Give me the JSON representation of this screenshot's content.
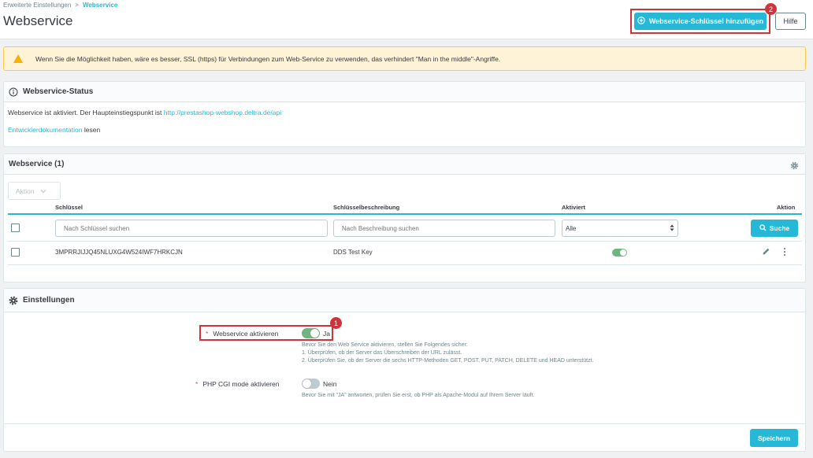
{
  "breadcrumb": {
    "parent": "Erweiterte Einstellungen",
    "separator": ">",
    "current": "Webservice"
  },
  "header": {
    "title": "Webservice",
    "add_key_label": "Webservice-Schlüssel hinzufügen",
    "help_label": "Hilfe",
    "callout_add": "2"
  },
  "alert": {
    "text": "Wenn Sie die Möglichkeit haben, wäre es besser, SSL (https) für Verbindungen zum Web-Service zu verwenden, das verhindert \"Man in the middle\"-Angriffe."
  },
  "status_card": {
    "title": "Webservice-Status",
    "line1_prefix": "Webservice ist aktiviert. Der Haupteinstiegspunkt ist ",
    "line1_link": "http://prestashop-webshop.deltra.de/api",
    "line2_link": "Entwicklerdokumentation",
    "line2_suffix": " lesen"
  },
  "list_card": {
    "title": "Webservice (1)",
    "bulk_action_label": "Aktion",
    "columns": {
      "key": "Schlüssel",
      "description": "Schlüsselbeschreibung",
      "enabled": "Aktiviert",
      "action": "Aktion"
    },
    "filters": {
      "key_placeholder": "Nach Schlüssel suchen",
      "description_placeholder": "Nach Beschreibung suchen",
      "enabled_value": "Alle",
      "search_label": "Suche"
    },
    "rows": [
      {
        "key": "3MPRRJIJJQ45NLUXG4W524IWF7HRKCJN",
        "description": "DDS Test Key",
        "enabled": true
      }
    ]
  },
  "settings_card": {
    "title": "Einstellungen",
    "webservice_label": "Webservice aktivieren",
    "webservice_state": "Ja",
    "webservice_enabled": true,
    "callout_toggle": "1",
    "webservice_help": [
      "Bevor Sie den Web Service aktivieren, stellen Sie Folgendes sicher:",
      "1. Überprüfen, ob der Server das Überschreiben der URL zulässt.",
      "2. Überprüfen Sie, ob der Server die sechs HTTP-Methoden GET, POST, PUT, PATCH, DELETE und HEAD unterstützt."
    ],
    "cgi_label": "PHP CGI mode aktivieren",
    "cgi_state": "Nein",
    "cgi_enabled": false,
    "cgi_help": "Bevor Sie mit \"JA\" antworten, prüfen Sie erst, ob PHP als Apache-Modul auf Ihrem Server läuft.",
    "save_label": "Speichern",
    "required_mark": "*"
  },
  "colors": {
    "accent": "#25b9d7",
    "highlight": "#d0343a",
    "toggle_on": "#70b580",
    "toggle_off": "#bbcdd2",
    "alert_bg": "#fff3d7"
  },
  "icons": [
    "plus-circle-icon",
    "warning-icon",
    "info-icon",
    "gear-icon",
    "chevron-down-icon",
    "search-icon",
    "edit-icon",
    "more-vertical-icon",
    "sort-icon"
  ]
}
